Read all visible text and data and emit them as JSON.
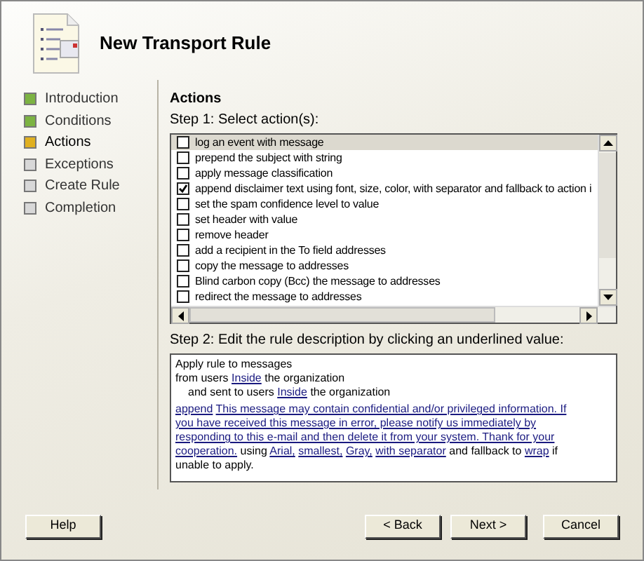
{
  "header": {
    "title": "New Transport Rule"
  },
  "steps": [
    {
      "label": "Introduction",
      "color": "#7cb342",
      "selected": false
    },
    {
      "label": "Conditions",
      "color": "#7cb342",
      "selected": false
    },
    {
      "label": "Actions",
      "color": "#e0b020",
      "selected": true
    },
    {
      "label": "Exceptions",
      "color": "#d8d8d8",
      "selected": false
    },
    {
      "label": "Create Rule",
      "color": "#d8d8d8",
      "selected": false
    },
    {
      "label": "Completion",
      "color": "#d8d8d8",
      "selected": false
    }
  ],
  "page_title": "Actions",
  "step1_label": "Step 1: Select action(s):",
  "actions": [
    {
      "label": "log an event with message",
      "checked": false,
      "selected": true
    },
    {
      "label": "prepend the subject with string",
      "checked": false,
      "selected": false
    },
    {
      "label": "apply message classification",
      "checked": false,
      "selected": false
    },
    {
      "label": "append disclaimer text using font, size, color, with separator and fallback to action i",
      "checked": true,
      "selected": false
    },
    {
      "label": "set the spam confidence level to value",
      "checked": false,
      "selected": false
    },
    {
      "label": "set header with value",
      "checked": false,
      "selected": false
    },
    {
      "label": "remove header",
      "checked": false,
      "selected": false
    },
    {
      "label": "add a recipient in the To field addresses",
      "checked": false,
      "selected": false
    },
    {
      "label": "copy the message to addresses",
      "checked": false,
      "selected": false
    },
    {
      "label": "Blind carbon copy (Bcc) the message to addresses",
      "checked": false,
      "selected": false
    },
    {
      "label": "redirect the message to addresses",
      "checked": false,
      "selected": false
    }
  ],
  "step2_label": "Step 2: Edit the rule description by clicking an underlined value:",
  "description": [
    {
      "indent": false,
      "segments": [
        {
          "text": "Apply rule to messages",
          "link": false
        }
      ]
    },
    {
      "indent": false,
      "segments": [
        {
          "text": "from users",
          "link": false
        },
        {
          "text": "Inside",
          "link": true
        },
        {
          "text": "the organization",
          "link": false
        }
      ]
    },
    {
      "indent": true,
      "segments": [
        {
          "text": "and sent to users",
          "link": false
        },
        {
          "text": "Inside",
          "link": true
        },
        {
          "text": "the organization",
          "link": false
        }
      ]
    },
    {
      "indent": false,
      "segments": [
        {
          "text": "append",
          "link": true
        },
        {
          "text": "This message may contain confidential and/or privileged information. If",
          "link": true
        }
      ]
    },
    {
      "indent": false,
      "segments": [
        {
          "text": "you have received this message in error, please notify us immediately by",
          "link": true
        }
      ]
    },
    {
      "indent": false,
      "segments": [
        {
          "text": "responding to this e-mail and then delete it from your system. Thank for your",
          "link": true
        }
      ]
    },
    {
      "indent": false,
      "segments": [
        {
          "text": "cooperation.",
          "link": true
        },
        {
          "text": "using",
          "link": false
        },
        {
          "text": "Arial,",
          "link": true
        },
        {
          "text": "smallest,",
          "link": true
        },
        {
          "text": "Gray,",
          "link": true
        },
        {
          "text": "with separator",
          "link": true
        },
        {
          "text": "and fallback to",
          "link": false
        },
        {
          "text": "wrap",
          "link": true
        },
        {
          "text": "if",
          "link": false
        }
      ]
    },
    {
      "indent": false,
      "segments": [
        {
          "text": "unable to apply.",
          "link": false
        }
      ]
    }
  ],
  "buttons": {
    "help": "Help",
    "back": "< Back",
    "next": "Next >",
    "cancel": "Cancel"
  }
}
